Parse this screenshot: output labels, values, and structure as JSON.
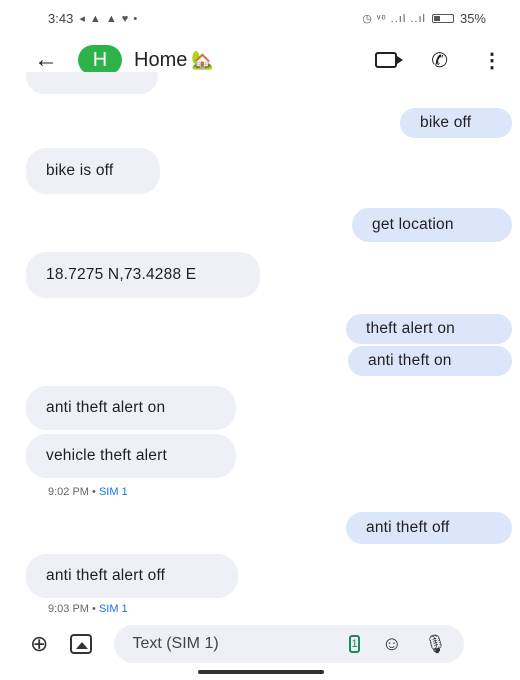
{
  "status": {
    "time": "3:43",
    "left_icons": "◂ ▲ ▲ ♥ •",
    "right_icons": "◷ ᵛᵒ ..ıl ..ıl",
    "battery": "35%"
  },
  "header": {
    "avatar_letter": "H",
    "title": "Home",
    "title_emoji": "🏡"
  },
  "messages": [
    {
      "dir": "out",
      "text": "bike off"
    },
    {
      "dir": "in",
      "text": "bike is off"
    },
    {
      "dir": "out",
      "text": "get location"
    },
    {
      "dir": "in",
      "text": "18.7275 N,73.4288 E"
    },
    {
      "dir": "out",
      "text": "theft alert on"
    },
    {
      "dir": "out",
      "text": "anti theft on"
    },
    {
      "dir": "in",
      "text": "anti theft alert on"
    },
    {
      "dir": "in",
      "text": "vehicle theft alert"
    },
    {
      "dir": "out",
      "text": "anti theft off"
    },
    {
      "dir": "in",
      "text": "anti theft alert off"
    }
  ],
  "meta": [
    {
      "time": "9:02 PM",
      "sep": " • ",
      "sim": "SIM 1"
    },
    {
      "time": "9:03 PM",
      "sep": " • ",
      "sim": "SIM 1"
    }
  ],
  "composer": {
    "placeholder": "Text (SIM 1)",
    "sim_badge": "1"
  }
}
